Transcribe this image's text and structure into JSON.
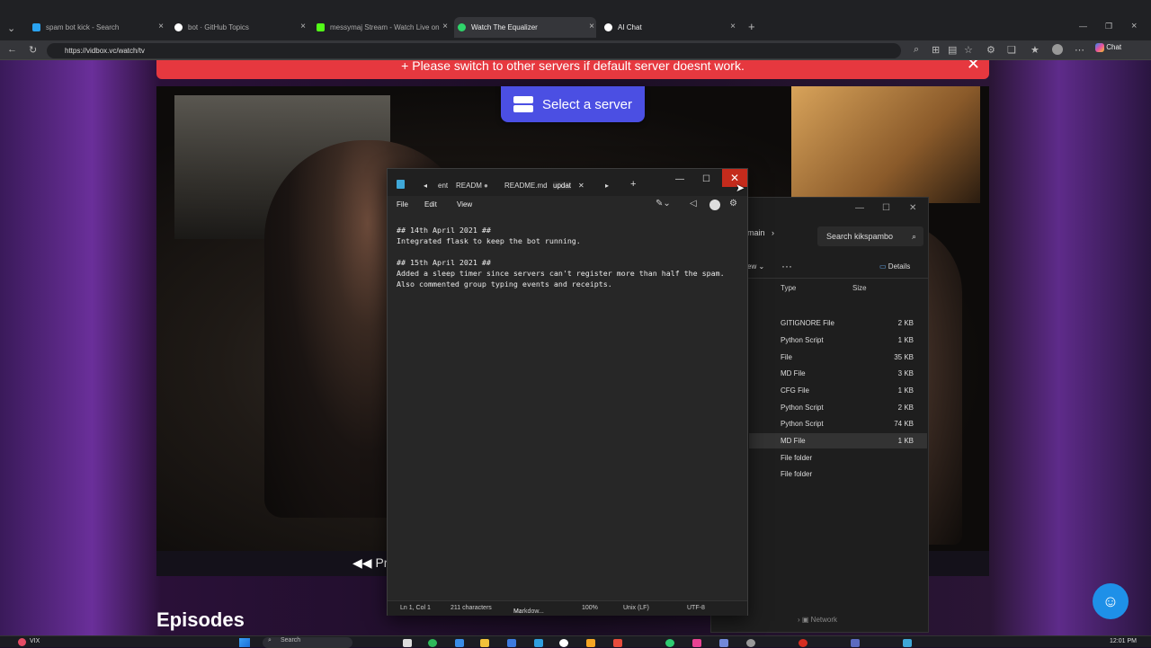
{
  "browser": {
    "tabs": [
      {
        "label": "spam bot kick - Search",
        "color": "#2aa3f0"
      },
      {
        "label": "bot · GitHub Topics",
        "color": "#ffffff"
      },
      {
        "label": "messymaj Stream - Watch Live on",
        "color": "#53fc18"
      },
      {
        "label": "Watch The Equalizer",
        "color": "#2fd46a"
      },
      {
        "label": "AI Chat",
        "color": "#ffffff"
      }
    ],
    "url": "https://vidbox.vc/watch/tv",
    "chat_label": "Chat"
  },
  "site": {
    "banner_text": "Please switch to other servers if default server doesnt work.",
    "select_server_label": "Select a server",
    "prev_label": "Pre",
    "episodes_heading": "Episodes"
  },
  "explorer": {
    "breadcrumb": "main",
    "search_placeholder": "Search kikspambo",
    "view_label": "ew",
    "details_label": "Details",
    "columns": {
      "type": "Type",
      "size": "Size"
    },
    "files": [
      {
        "type": "GITIGNORE File",
        "size": "2 KB"
      },
      {
        "type": "Python Script",
        "size": "1 KB"
      },
      {
        "type": "File",
        "size": "35 KB"
      },
      {
        "type": "MD File",
        "size": "3 KB"
      },
      {
        "type": "CFG File",
        "size": "1 KB"
      },
      {
        "type": "Python Script",
        "size": "2 KB"
      },
      {
        "type": "Python Script",
        "size": "74 KB"
      },
      {
        "type": "MD File",
        "size": "1 KB"
      },
      {
        "type": "File folder",
        "size": ""
      },
      {
        "type": "File folder",
        "size": ""
      }
    ],
    "network_label": "Network"
  },
  "notepad": {
    "tabs": [
      "ent",
      "READM",
      "README.md",
      "updat"
    ],
    "menu": {
      "file": "File",
      "edit": "Edit",
      "view": "View"
    },
    "content": "## 14th April 2021 ##\nIntegrated flask to keep the bot running.\n\n## 15th April 2021 ##\nAdded a sleep timer since servers can't register more than half the spam.\nAlso commented group typing events and receipts.",
    "status": {
      "position": "Ln 1, Col 1",
      "chars": "211 characters",
      "format": "Markdow...",
      "zoom": "100%",
      "eol": "Unix (LF)",
      "encoding": "UTF-8"
    }
  },
  "taskbar": {
    "weather": "VIX",
    "search_label": "Search",
    "clock": "12:01 PM"
  }
}
